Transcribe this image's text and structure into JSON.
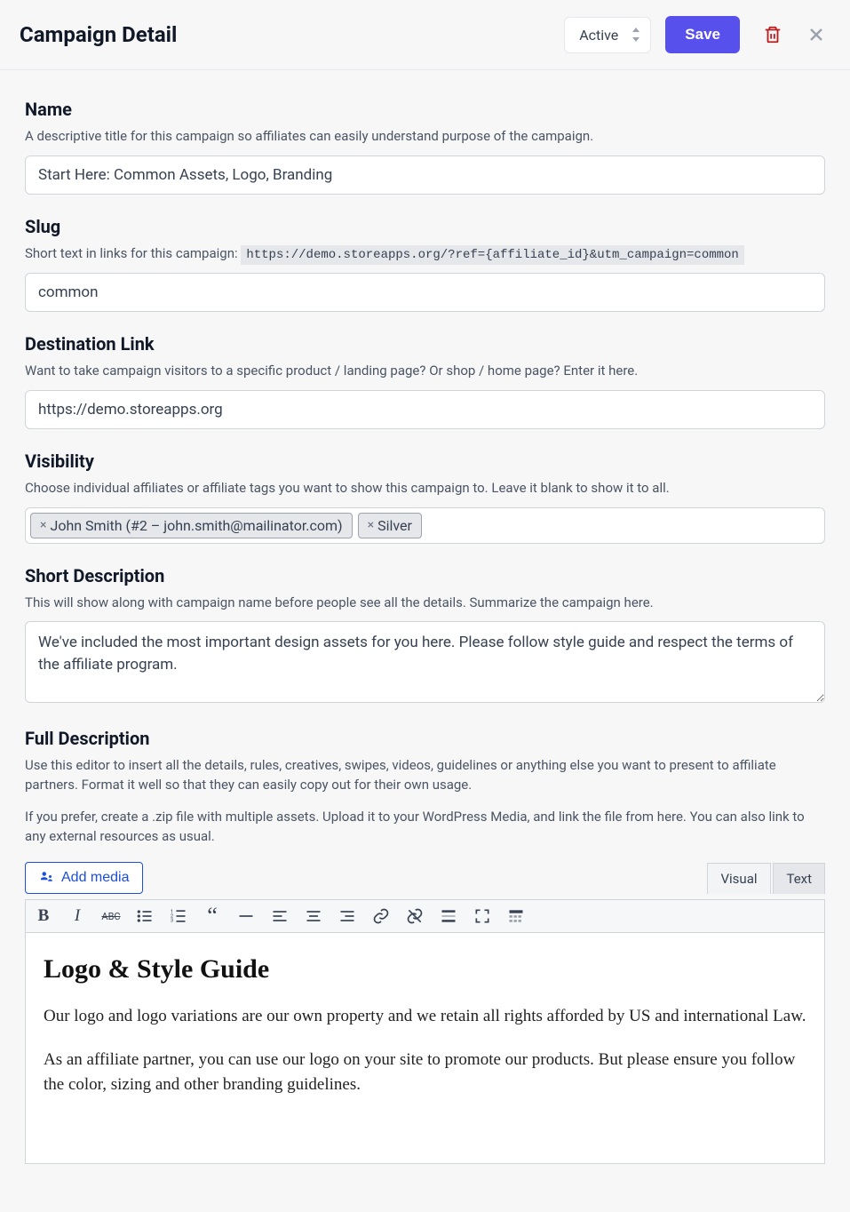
{
  "header": {
    "title": "Campaign Detail",
    "status": "Active",
    "save_label": "Save"
  },
  "name": {
    "label": "Name",
    "help": "A descriptive title for this campaign so affiliates can easily understand purpose of the campaign.",
    "value": "Start Here: Common Assets, Logo, Branding"
  },
  "slug": {
    "label": "Slug",
    "help_prefix": "Short text in links for this campaign: ",
    "url_example": "https://demo.storeapps.org/?ref={affiliate_id}&utm_campaign=common",
    "value": "common"
  },
  "dest": {
    "label": "Destination Link",
    "help": "Want to take campaign visitors to a specific product / landing page? Or shop / home page? Enter it here.",
    "value": "https://demo.storeapps.org"
  },
  "visibility": {
    "label": "Visibility",
    "help": "Choose individual affiliates or affiliate tags you want to show this campaign to. Leave it blank to show it to all.",
    "tags": [
      "John Smith (#2 – john.smith@mailinator.com)",
      "Silver"
    ]
  },
  "short_desc": {
    "label": "Short Description",
    "help": "This will show along with campaign name before people see all the details. Summarize the campaign here.",
    "value": "We've included the most important design assets for you here. Please follow style guide and respect the terms of the affiliate program."
  },
  "full_desc": {
    "label": "Full Description",
    "help1": "Use this editor to insert all the details, rules, creatives, swipes, videos, guidelines or anything else you want to present to affiliate partners. Format it well so that they can easily copy out for their own usage.",
    "help2": "If you prefer, create a .zip file with multiple assets. Upload it to your WordPress Media, and link the file from here. You can also link to any external resources as usual."
  },
  "editor": {
    "add_media": "Add media",
    "tab_visual": "Visual",
    "tab_text": "Text",
    "content_heading": "Logo & Style Guide",
    "content_p1": "Our logo and logo variations are our own property and we retain all rights afforded by US and international Law.",
    "content_p2": "As an affiliate partner, you can use our logo on your site to promote our products. But please ensure you follow the color, sizing and other branding guidelines."
  }
}
